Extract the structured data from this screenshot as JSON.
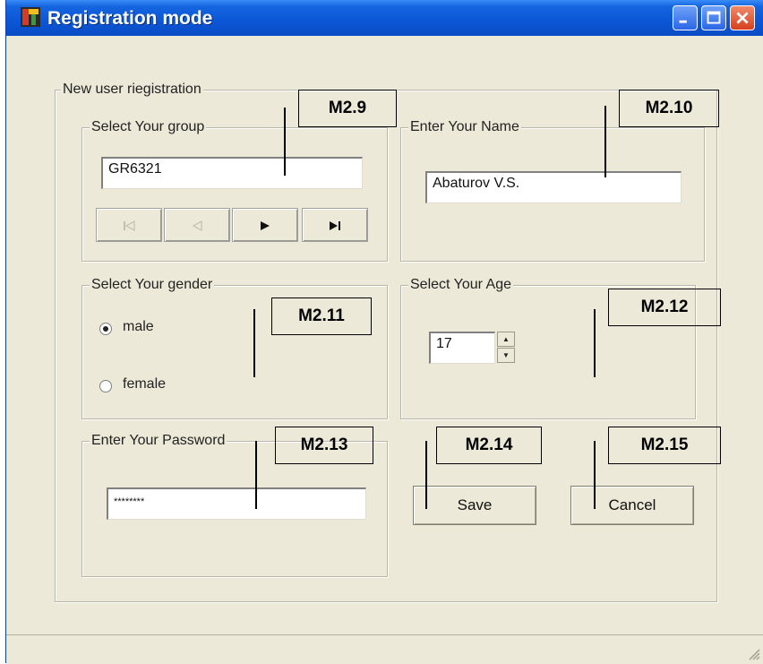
{
  "window": {
    "title": "Registration mode",
    "controls": [
      "minimize-icon",
      "maximize-icon",
      "close-icon"
    ]
  },
  "form": {
    "outer_group_label": "New user riegistration",
    "group": {
      "label": "Select Your group",
      "value": "GR6321",
      "nav_buttons": [
        "first-record-icon",
        "prev-record-icon",
        "next-record-icon",
        "last-record-icon"
      ]
    },
    "name": {
      "label": "Enter Your Name",
      "value": "Abaturov V.S."
    },
    "gender": {
      "label": "Select Your gender",
      "options": [
        "male",
        "female"
      ],
      "selected": "male"
    },
    "age": {
      "label": "Select Your Age",
      "value": "17"
    },
    "password": {
      "label": "Enter Your Password",
      "value": "********"
    },
    "save_label": "Save",
    "cancel_label": "Cancel"
  },
  "annotations": [
    "M2.9",
    "M2.10",
    "M2.11",
    "M2.12",
    "M2.13",
    "M2.14",
    "M2.15"
  ],
  "colors": {
    "titlebar": "#0b56d6",
    "window_bg": "#ece9d8",
    "close_button": "#d6401e"
  }
}
